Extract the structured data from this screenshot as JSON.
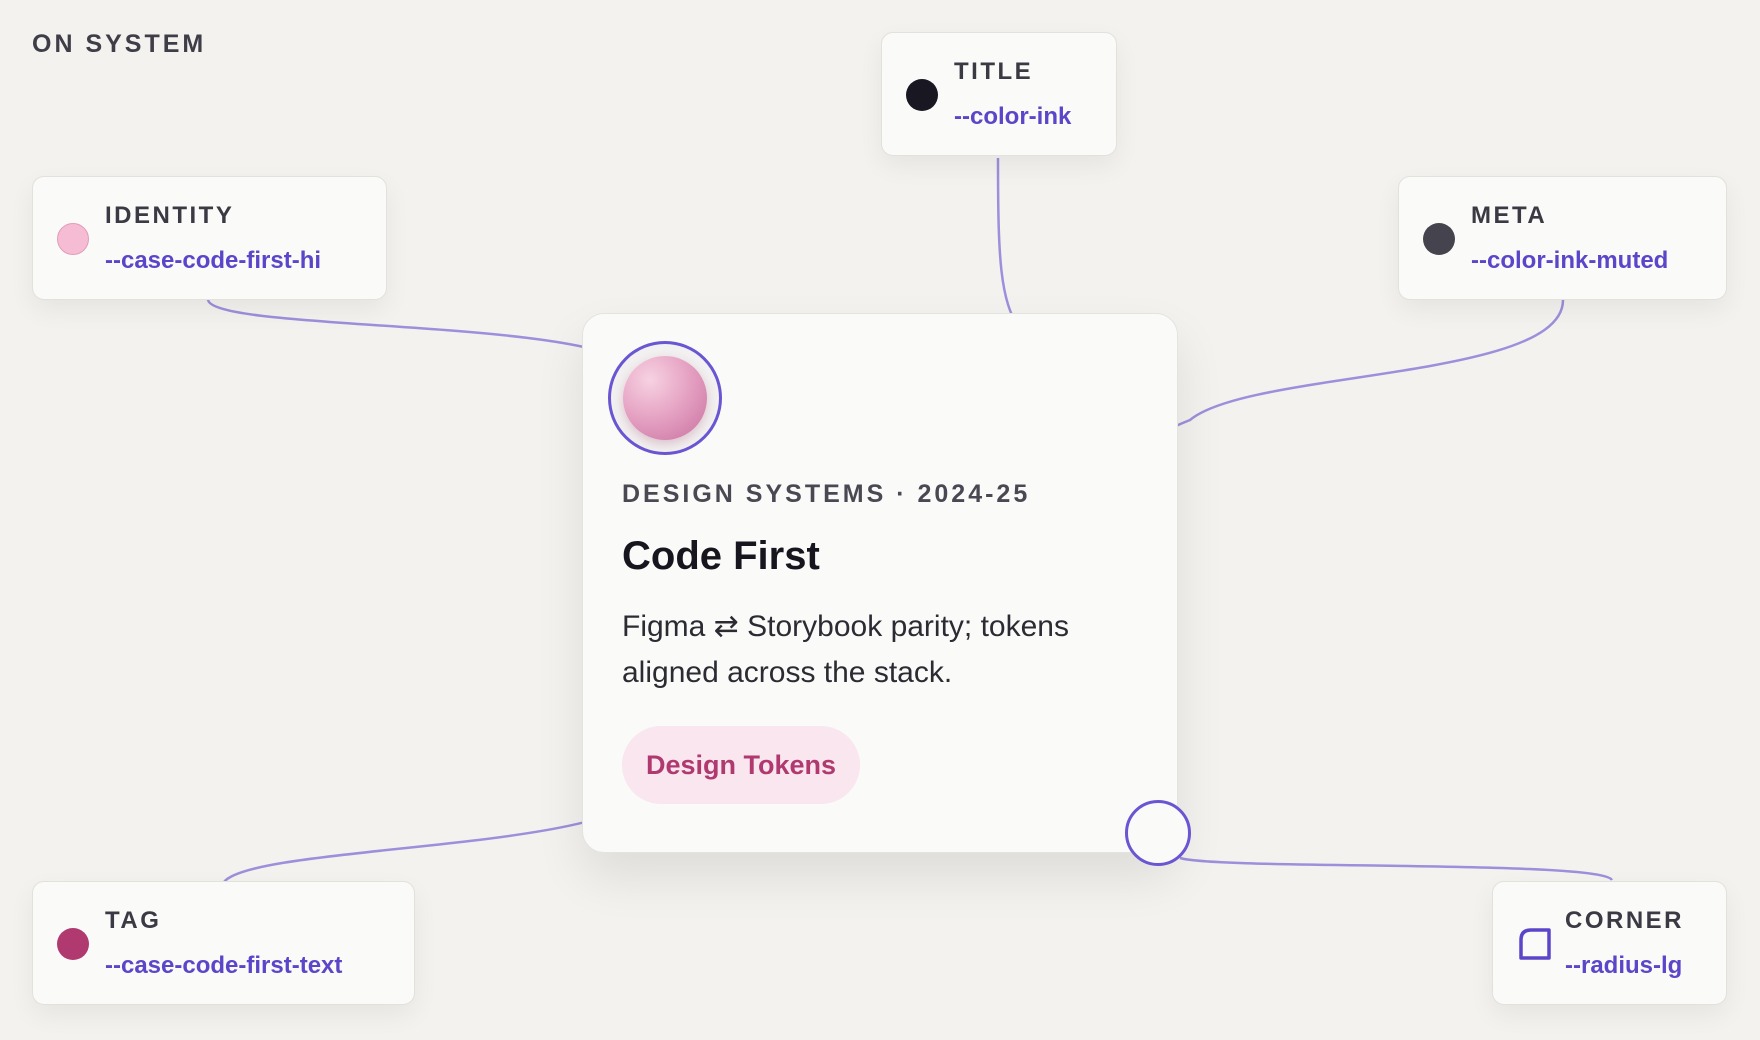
{
  "header": {
    "eyebrow": "ON SYSTEM"
  },
  "callouts": {
    "title": {
      "label": "TITLE",
      "token": "--color-ink",
      "swatch_color": "#181722"
    },
    "identity": {
      "label": "IDENTITY",
      "token": "--case-code-first-hi",
      "swatch_color": "#f6bcd4"
    },
    "meta": {
      "label": "META",
      "token": "--color-ink-muted",
      "swatch_color": "#45444e"
    },
    "tag": {
      "label": "TAG",
      "token": "--case-code-first-text",
      "swatch_color": "#b0396f"
    },
    "corner": {
      "label": "CORNER",
      "token": "--radius-lg",
      "icon": "corner-radius-icon"
    }
  },
  "card": {
    "meta": "DESIGN SYSTEMS · 2024-25",
    "title": "Code First",
    "description": "Figma ⇄ Storybook parity; tokens aligned across the stack.",
    "tag": "Design Tokens"
  },
  "colors": {
    "accent": "#5b46c9",
    "wire": "#9d8fdb",
    "background": "#f3f2ee",
    "card": "#fafaf8",
    "tag_bg": "#f9e6ee",
    "tag_text": "#b0396f"
  }
}
